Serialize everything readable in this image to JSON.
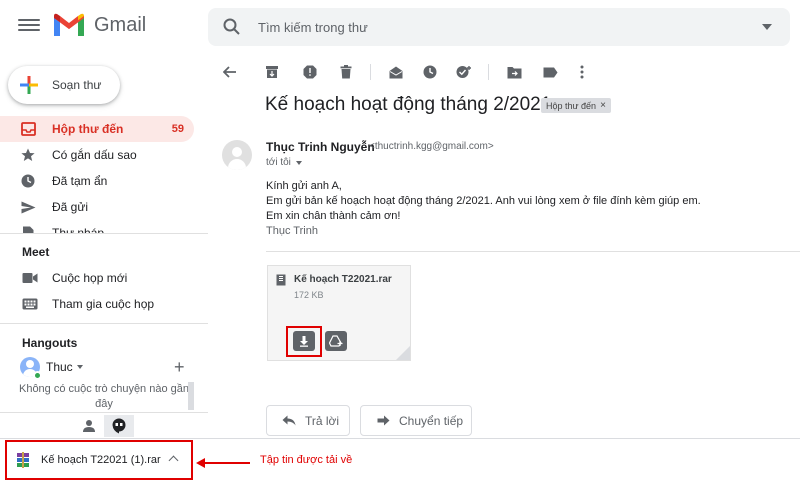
{
  "app": {
    "name": "Gmail"
  },
  "search": {
    "placeholder": "Tìm kiếm trong thư"
  },
  "compose": {
    "label": "Soạn thư"
  },
  "sidebar": {
    "items": [
      {
        "label": "Hộp thư đến",
        "count": "59",
        "icon": "inbox-icon"
      },
      {
        "label": "Có gắn dấu sao",
        "icon": "star-icon"
      },
      {
        "label": "Đã tạm ẩn",
        "icon": "clock-icon"
      },
      {
        "label": "Đã gửi",
        "icon": "send-icon"
      },
      {
        "label": "Thư nháp",
        "icon": "draft-icon"
      }
    ]
  },
  "meet": {
    "title": "Meet",
    "new_meeting": "Cuộc họp mới",
    "join_meeting": "Tham gia cuộc họp"
  },
  "hangouts": {
    "title": "Hangouts",
    "user": "Thuc",
    "empty": "Không có cuộc trò chuyện nào gần đây"
  },
  "email": {
    "subject": "Kế hoạch hoạt động tháng 2/2021",
    "label": "Hộp thư đến",
    "sender_name": "Thục Trinh Nguyễn",
    "sender_email": "<thuctrinh.kgg@gmail.com>",
    "to": "tới tôi",
    "body": [
      "Kính gửi anh A,",
      "Em gửi bản kế hoạch hoạt động tháng 2/2021. Anh vui lòng xem ở file đính kèm giúp em.",
      "Em xin chân thành cảm ơn!"
    ],
    "signature": "Thục Trinh",
    "attachment": {
      "name": "Kế hoạch T22021.rar",
      "size": "172 KB"
    },
    "reply": "Trả lời",
    "forward": "Chuyển tiếp"
  },
  "download": {
    "filename": "Kế hoạch T22021 (1).rar",
    "annotation": "Tập tin được tải về"
  },
  "colors": {
    "accent_red": "#d93025",
    "highlight": "#e00000",
    "active_bg": "#fce8e6"
  }
}
